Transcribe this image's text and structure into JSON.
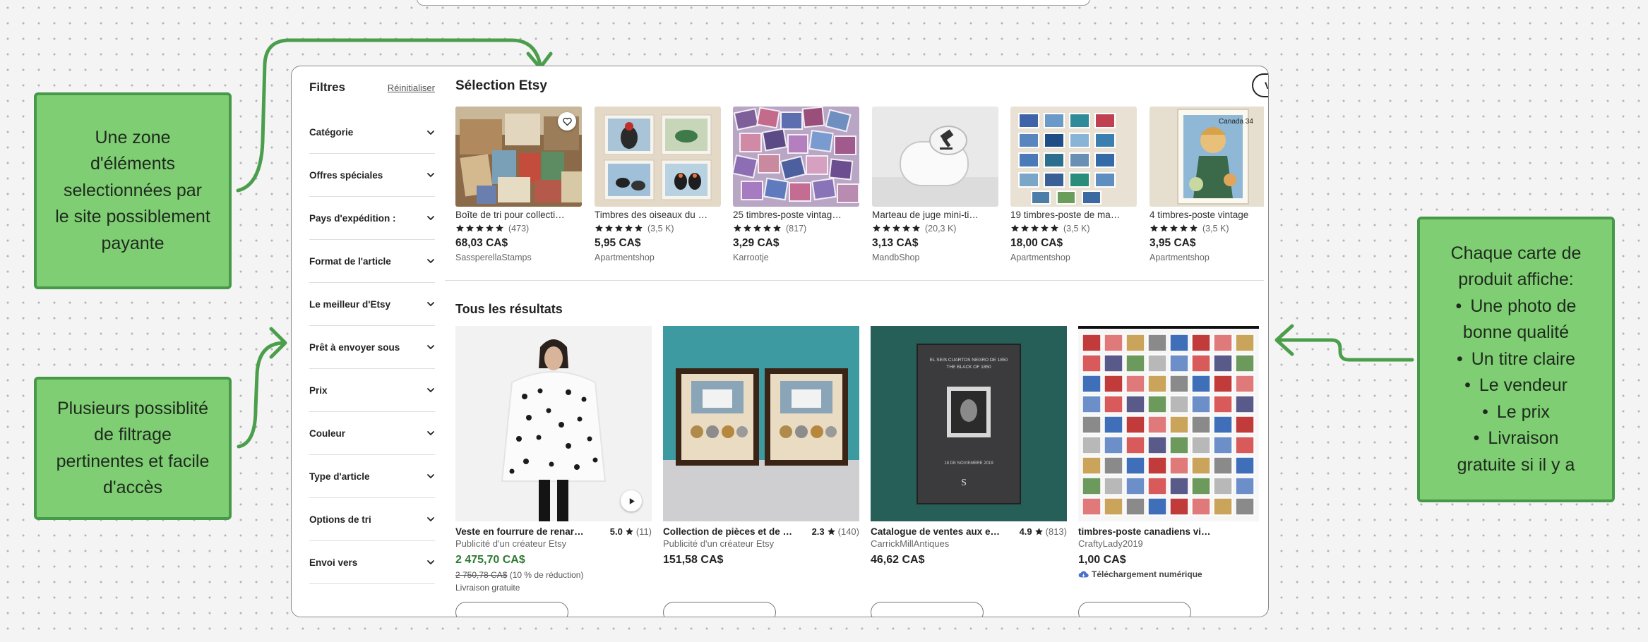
{
  "sidebar": {
    "title": "Filtres",
    "reset": "Réinitialiser",
    "filters": [
      "Catégorie",
      "Offres spéciales",
      "Pays d'expédition :",
      "Format de l'article",
      "Le meilleur d'Etsy",
      "Prêt à envoyer sous",
      "Prix",
      "Couleur",
      "Type d'article",
      "Options de tri",
      "Envoi vers"
    ]
  },
  "selection": {
    "title": "Sélection Etsy",
    "voir_plus": "Voir plus",
    "items": [
      {
        "title": "Boîte de tri pour collecti…",
        "rating_count": "(473)",
        "price": "68,03 CA$",
        "shop": "SassperellaStamps"
      },
      {
        "title": "Timbres des oiseaux du …",
        "rating_count": "(3,5 K)",
        "price": "5,95 CA$",
        "shop": "Apartmentshop"
      },
      {
        "title": "25 timbres-poste vintag…",
        "rating_count": "(817)",
        "price": "3,29 CA$",
        "shop": "Karrootje"
      },
      {
        "title": "Marteau de juge mini-ti…",
        "rating_count": "(20,3 K)",
        "price": "3,13 CA$",
        "shop": "MandbShop"
      },
      {
        "title": "19 timbres-poste de ma…",
        "rating_count": "(3,5 K)",
        "price": "18,00 CA$",
        "shop": "Apartmentshop"
      },
      {
        "title": "4 timbres-poste vintage",
        "rating_count": "(3,5 K)",
        "price": "3,95 CA$",
        "shop": "Apartmentshop"
      }
    ],
    "stamp_label": "Canada 34"
  },
  "results": {
    "title": "Tous les résultats",
    "items": [
      {
        "title": "Veste en fourrure de renar…",
        "rating": "5.0",
        "rating_count": "(11)",
        "subtitle": "Publicité d'un créateur Etsy",
        "price": "2 475,70 CA$",
        "original_price": "2 750,78 CA$",
        "discount": "(10 % de réduction)",
        "shipping": "Livraison gratuite"
      },
      {
        "title": "Collection de pièces et de …",
        "rating": "2.3",
        "rating_count": "(140)",
        "subtitle": "Publicité d'un créateur Etsy",
        "price": "151,58 CA$"
      },
      {
        "title": "Catalogue de ventes aux e…",
        "rating": "4.9",
        "rating_count": "(813)",
        "subtitle": "CarrickMillAntiques",
        "price": "46,62 CA$",
        "book_line1": "EL SEIS CUARTOS NEGRO DE 1850",
        "book_line2": "THE BLACK OF 1850",
        "book_date": "18 DE NOVIEMBRE 2019"
      },
      {
        "title": "timbres-poste canadiens vi…",
        "subtitle": "CraftyLady2019",
        "price": "1,00 CA$",
        "digital": "Téléchargement numérique"
      }
    ]
  },
  "annotations": {
    "selection_note": "Une zone d'éléments selectionnées par le site possiblement payante",
    "filters_note": "Plusieurs possiblité de filtrage pertinentes et facile d'accès",
    "card_note_head": "Chaque carte de produit affiche:",
    "card_note_items": [
      "Une photo de",
      "bonne qualité",
      "Un titre claire",
      "Le vendeur",
      "Le prix",
      "Livraison",
      "gratuite si il y a"
    ]
  },
  "colors": {
    "note_fill": "#7fce73",
    "note_border": "#47994a",
    "arrow": "#4b9e4c",
    "sale_price": "#2f7a34",
    "digital_icon": "#4a72c9"
  },
  "icons": [
    "heart-icon",
    "chevron-down-icon",
    "star-icon",
    "play-icon",
    "cloud-download-icon"
  ]
}
